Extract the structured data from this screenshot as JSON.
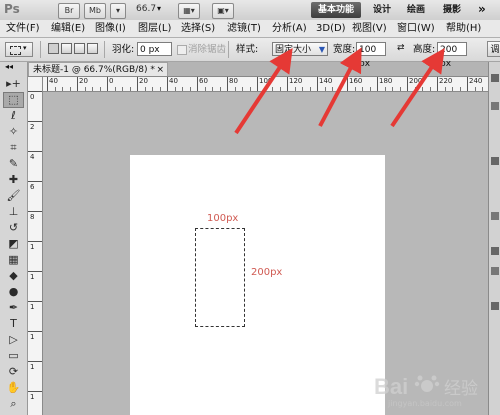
{
  "titlebar": {
    "app_logo": "Ps",
    "br_badge": "Br",
    "mb_badge": "Mb",
    "zoom": "66.7",
    "workspaces": [
      "基本功能",
      "设计",
      "绘画",
      "摄影"
    ],
    "more": "»"
  },
  "menubar": {
    "items": [
      "文件(F)",
      "编辑(E)",
      "图像(I)",
      "图层(L)",
      "选择(S)",
      "滤镜(T)",
      "分析(A)",
      "3D(D)",
      "视图(V)",
      "窗口(W)",
      "帮助(H)"
    ]
  },
  "options": {
    "feather_label": "羽化:",
    "feather_value": "0 px",
    "antialias_label": "消除锯齿",
    "style_label": "样式:",
    "style_value": "固定大小",
    "width_label": "宽度:",
    "width_value": "100 px",
    "height_label": "高度:",
    "height_value": "200 px",
    "refine_label": "调"
  },
  "document": {
    "tab_title": "未标题-1 @ 66.7%(RGB/8) *",
    "close_glyph": "×"
  },
  "ruler_top_labels": [
    "40",
    "20",
    "0",
    "20",
    "40",
    "60",
    "80",
    "100",
    "120",
    "140",
    "160",
    "180",
    "200",
    "220",
    "240"
  ],
  "ruler_left_labels": [
    "0",
    "2",
    "4",
    "6",
    "8",
    "1",
    "1",
    "1",
    "1",
    "1",
    "1"
  ],
  "annotations": {
    "width_text": "100px",
    "height_text": "200px",
    "arrow_color": "#e53935",
    "text_color": "#d05a52"
  },
  "watermark": {
    "brand": "Bai",
    "brand_suffix": "经验",
    "site": "jingyan.baidu.com"
  },
  "tools": [
    {
      "name": "move-tool",
      "glyph": "▸+"
    },
    {
      "name": "marquee-tool",
      "glyph": "⬚"
    },
    {
      "name": "lasso-tool",
      "glyph": "ℓ"
    },
    {
      "name": "quick-select-tool",
      "glyph": "✧"
    },
    {
      "name": "crop-tool",
      "glyph": "⌗"
    },
    {
      "name": "eyedropper-tool",
      "glyph": "✎"
    },
    {
      "name": "healing-brush-tool",
      "glyph": "✚"
    },
    {
      "name": "brush-tool",
      "glyph": "🖌"
    },
    {
      "name": "clone-stamp-tool",
      "glyph": "⊥"
    },
    {
      "name": "history-brush-tool",
      "glyph": "↺"
    },
    {
      "name": "eraser-tool",
      "glyph": "◩"
    },
    {
      "name": "gradient-tool",
      "glyph": "▦"
    },
    {
      "name": "blur-tool",
      "glyph": "◆"
    },
    {
      "name": "dodge-tool",
      "glyph": "●"
    },
    {
      "name": "pen-tool",
      "glyph": "✒"
    },
    {
      "name": "type-tool",
      "glyph": "T"
    },
    {
      "name": "path-select-tool",
      "glyph": "▷"
    },
    {
      "name": "shape-tool",
      "glyph": "▭"
    },
    {
      "name": "3d-rotate-tool",
      "glyph": "⟳"
    },
    {
      "name": "hand-tool",
      "glyph": "✋"
    },
    {
      "name": "zoom-tool",
      "glyph": "⌕"
    }
  ]
}
